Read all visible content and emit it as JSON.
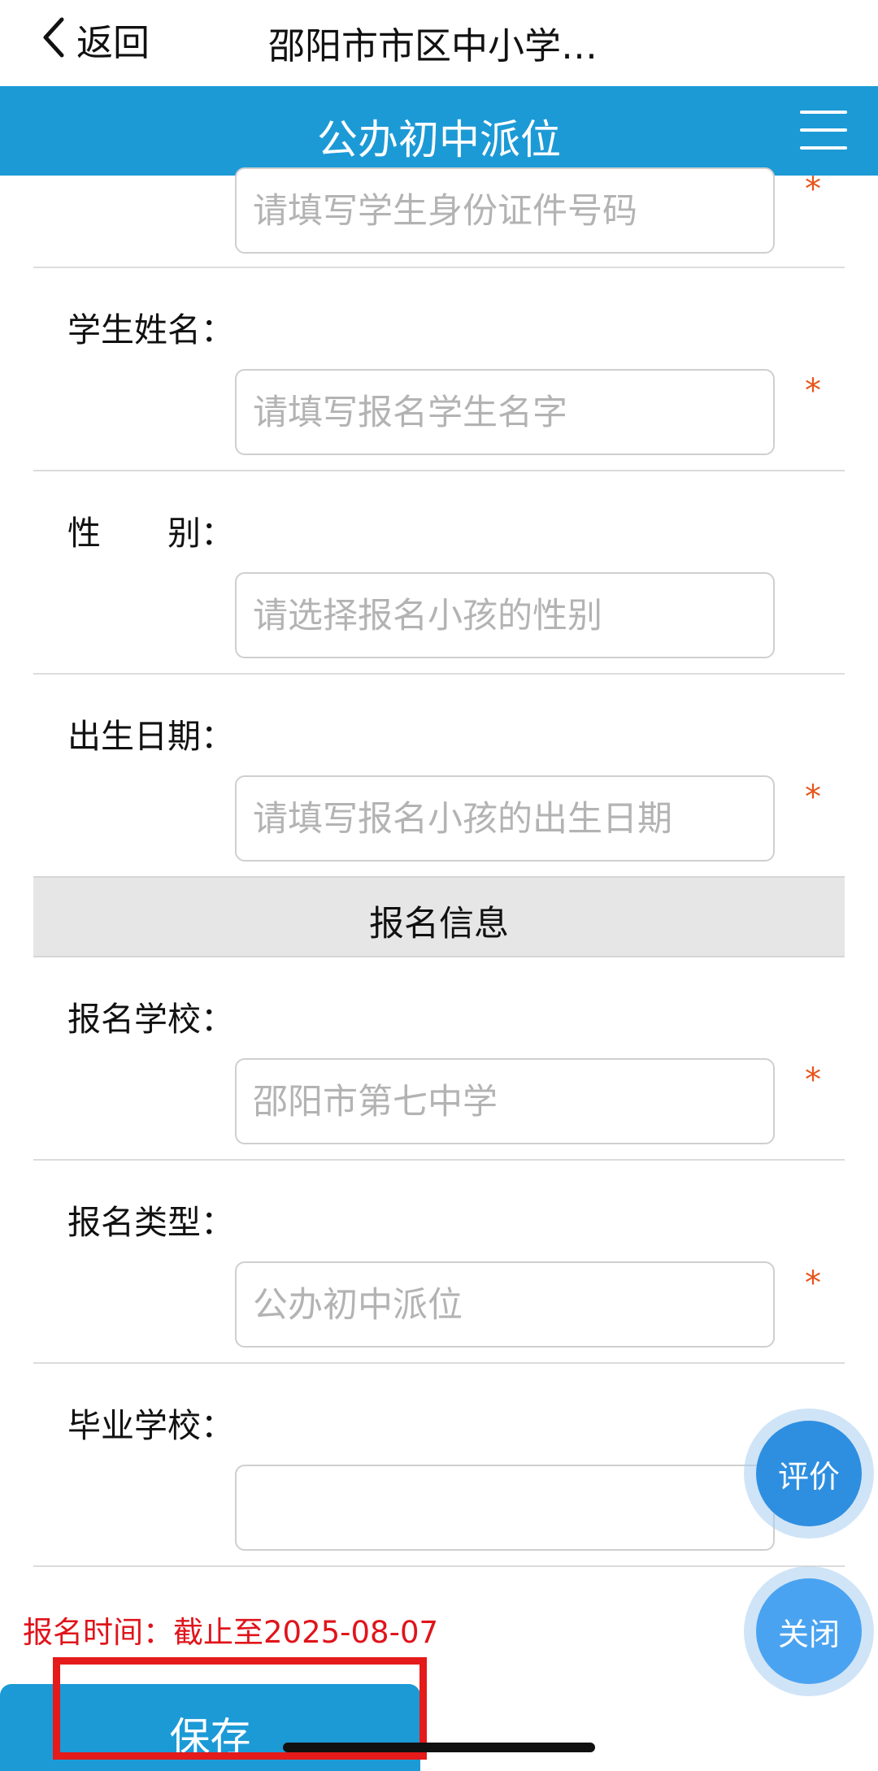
{
  "topbar": {
    "back_label": "返回",
    "title": "邵阳市市区中小学…"
  },
  "header": {
    "title": "公办初中派位"
  },
  "form": {
    "id_field": {
      "placeholder": "请填写学生身份证件号码",
      "required_mark": "*"
    },
    "name": {
      "label": "学生姓名：",
      "placeholder": "请填写报名学生名字",
      "required_mark": "*"
    },
    "gender": {
      "label": "性　　别：",
      "placeholder": "请选择报名小孩的性别"
    },
    "birthdate": {
      "label": "出生日期：",
      "placeholder": "请填写报名小孩的出生日期",
      "required_mark": "*"
    },
    "section_title": "报名信息",
    "school": {
      "label": "报名学校：",
      "placeholder": "邵阳市第七中学",
      "required_mark": "*"
    },
    "type": {
      "label": "报名类型：",
      "placeholder": "公办初中派位",
      "required_mark": "*"
    },
    "graduate_school": {
      "label": "毕业学校：",
      "placeholder": ""
    }
  },
  "footer": {
    "deadline": "报名时间：截止至2025-08-07",
    "save_label": "保存"
  },
  "floating": {
    "review_label": "评价",
    "close_label": "关闭"
  },
  "colors": {
    "brand_blue": "#1c9ad6",
    "required": "#e8541b",
    "deadline_red": "#e0141b",
    "highlight": "#e51a1a"
  },
  "icons": {
    "back": "chevron-left-icon",
    "menu": "hamburger-menu-icon"
  }
}
